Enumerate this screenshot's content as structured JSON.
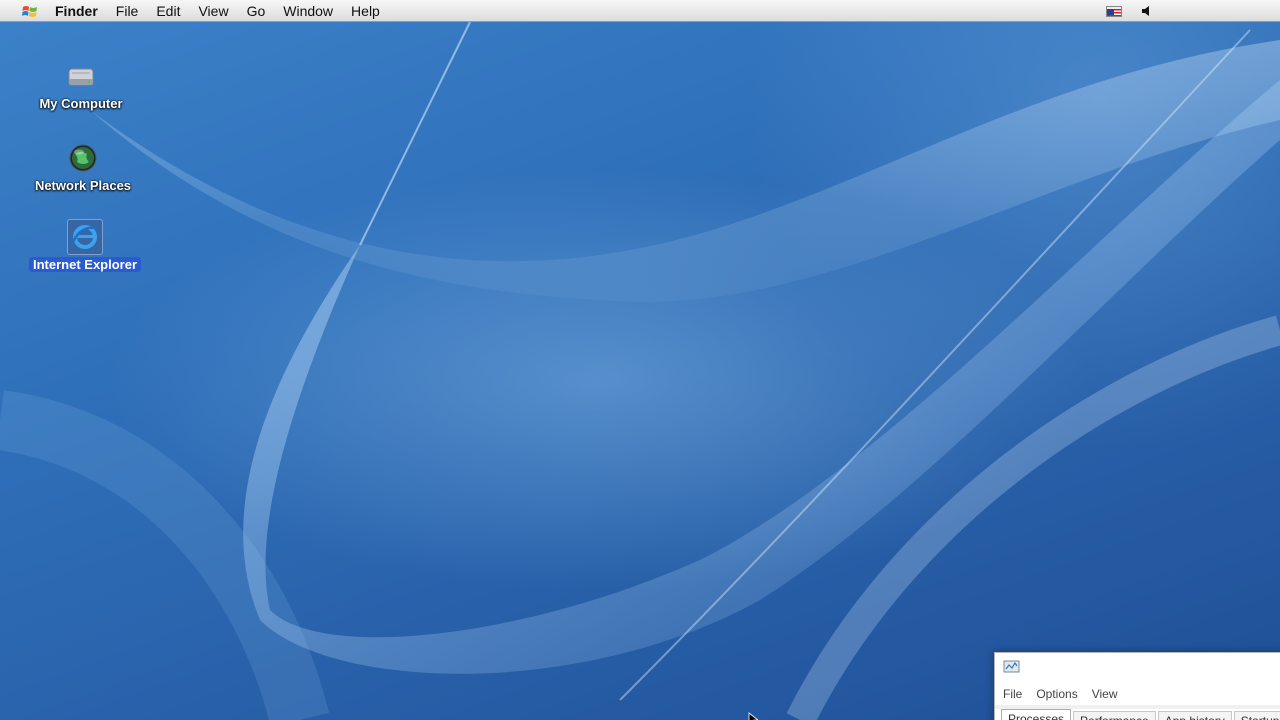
{
  "menubar": {
    "logo_icon": "windows-flag-logo-icon",
    "app_name": "Finder",
    "items": [
      "File",
      "Edit",
      "View",
      "Go",
      "Window",
      "Help"
    ],
    "status_icons": [
      "us-flag-icon",
      "speaker-volume-icon"
    ]
  },
  "desktop": {
    "icons": [
      {
        "label": "My Computer",
        "icon": "hard-drive-icon",
        "selected": false
      },
      {
        "label": "Network Places",
        "icon": "network-globe-icon",
        "selected": false
      },
      {
        "label": "Internet Explorer",
        "icon": "internet-explorer-icon",
        "selected": true
      }
    ]
  },
  "task_manager": {
    "title_icon": "task-manager-icon",
    "menu": [
      "File",
      "Options",
      "View"
    ],
    "tabs": [
      "Processes",
      "Performance",
      "App history",
      "Startup"
    ],
    "active_tab": "Processes"
  },
  "colors": {
    "wallpaper": "#2f6fb8",
    "selection": "#2a5bd0",
    "menubar": "#e8e8e8"
  }
}
